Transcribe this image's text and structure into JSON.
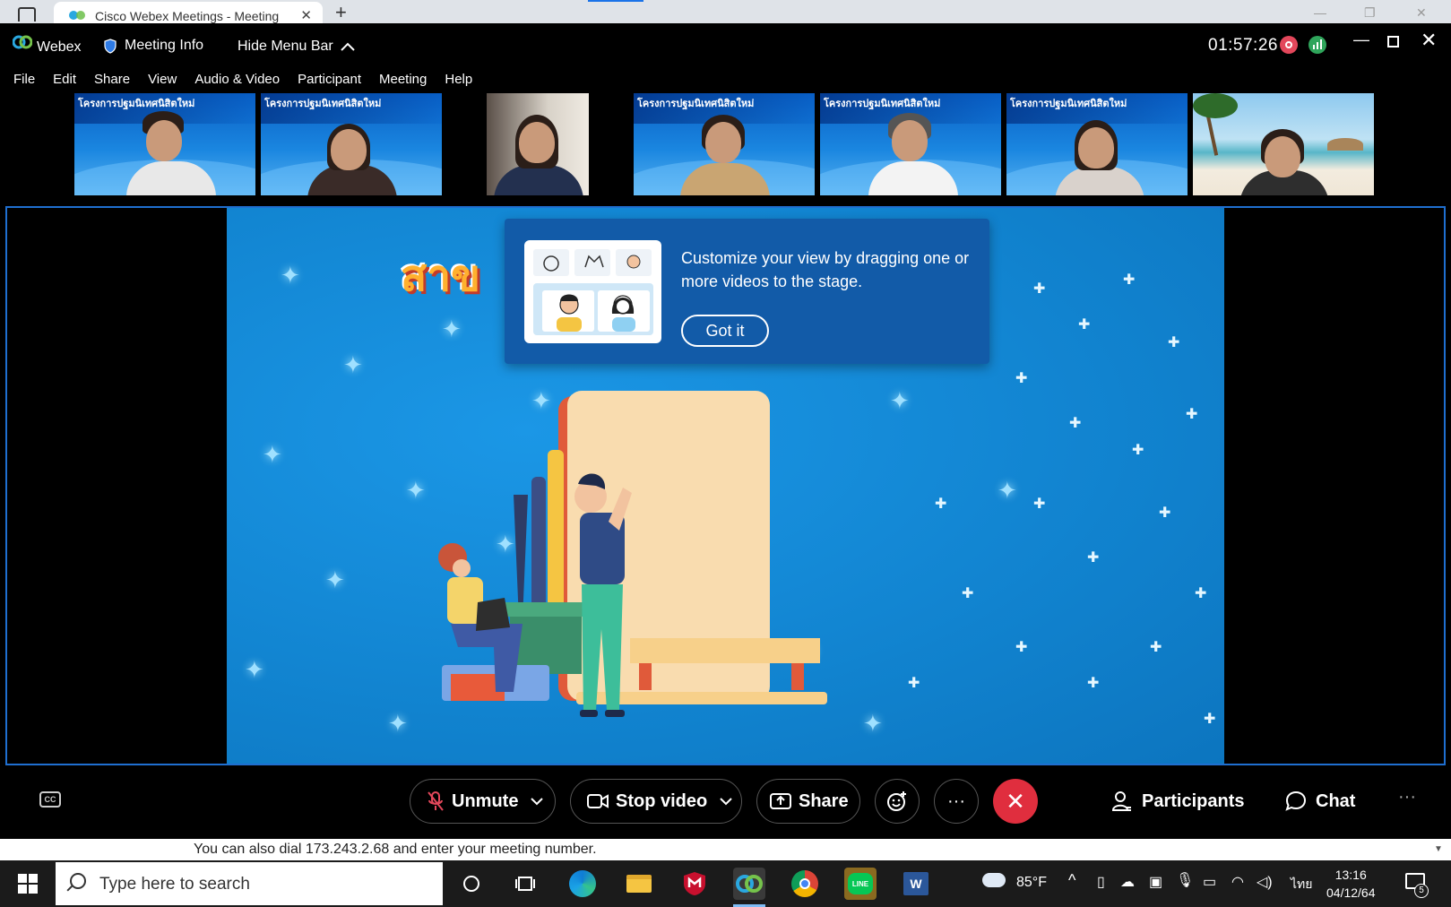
{
  "browser": {
    "tab_title": "Cisco Webex Meetings - Meeting",
    "new_tab": "+",
    "close": "✕"
  },
  "titlebar": {
    "app_name": "Webex",
    "meeting_info": "Meeting Info",
    "hide_menu": "Hide Menu Bar",
    "timer": "01:57:26"
  },
  "menu": [
    "File",
    "Edit",
    "Share",
    "View",
    "Audio & Video",
    "Participant",
    "Meeting",
    "Help"
  ],
  "thumbnails": [
    {
      "banner": "โครงการปฐมนิเทศนิสิตใหม่",
      "bg": "blue"
    },
    {
      "banner": "โครงการปฐมนิเทศนิสิตใหม่",
      "bg": "blue"
    },
    {
      "banner": "",
      "bg": "room"
    },
    {
      "banner": "โครงการปฐมนิเทศนิสิตใหม่",
      "bg": "blue"
    },
    {
      "banner": "โครงการปฐมนิเทศนิสิตใหม่",
      "bg": "blue"
    },
    {
      "banner": "โครงการปฐมนิเทศนิสิตใหม่",
      "bg": "blue"
    },
    {
      "banner": "",
      "bg": "beach"
    }
  ],
  "stage": {
    "slide_title": "สาข"
  },
  "tooltip": {
    "text": "Customize your view by dragging one or more videos to the stage.",
    "button": "Got it"
  },
  "controls": {
    "cc": "CC",
    "unmute": "Unmute",
    "stop_video": "Stop video",
    "share": "Share",
    "more": "···",
    "participants": "Participants",
    "chat": "Chat"
  },
  "dial_info": "You can also dial 173.243.2.68 and enter your meeting number.",
  "taskbar": {
    "search_placeholder": "Type here to search",
    "weather": "85°F",
    "language": "ไทย",
    "time": "13:16",
    "date": "04/12/64",
    "notifications": "5"
  },
  "colors": {
    "accent": "#1f6fd0",
    "end_call": "#e02e3e",
    "tooltip_bg": "#125ba8",
    "record": "#e3475b",
    "stats": "#2fa55b"
  }
}
